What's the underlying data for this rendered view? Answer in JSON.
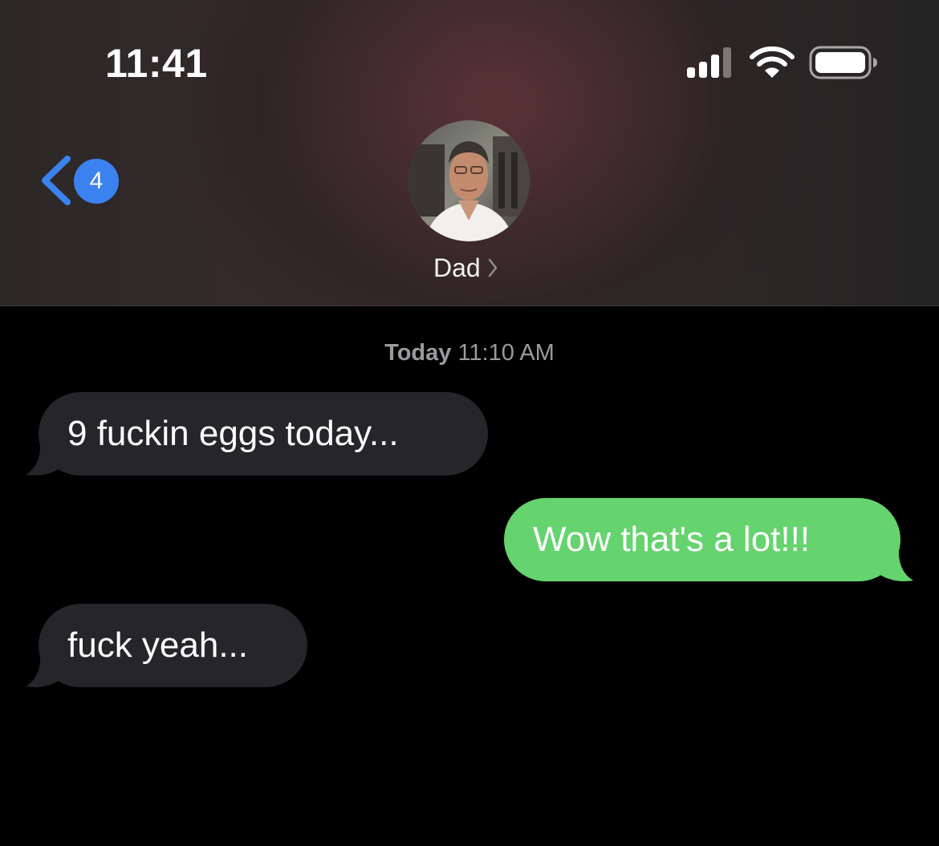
{
  "status_bar": {
    "time": "11:41",
    "signal_icon": "cellular-signal-icon",
    "wifi_icon": "wifi-icon",
    "battery_icon": "battery-icon"
  },
  "nav": {
    "back_icon": "chevron-left-icon",
    "unread_count": "4",
    "contact_name": "Dad",
    "contact_chevron_icon": "chevron-right-icon",
    "avatar": "contact-photo"
  },
  "conversation": {
    "timestamp_day": "Today",
    "timestamp_time": "11:10 AM",
    "messages": [
      {
        "direction": "incoming",
        "text": "9 fuckin eggs today..."
      },
      {
        "direction": "outgoing",
        "text": "Wow that's a lot!!!"
      },
      {
        "direction": "incoming",
        "text": "fuck yeah..."
      }
    ]
  },
  "colors": {
    "incoming_bubble": "#26252a",
    "outgoing_bubble": "#65d36e",
    "accent_blue": "#3b82f0",
    "timestamp_gray": "#9a9a9e"
  }
}
